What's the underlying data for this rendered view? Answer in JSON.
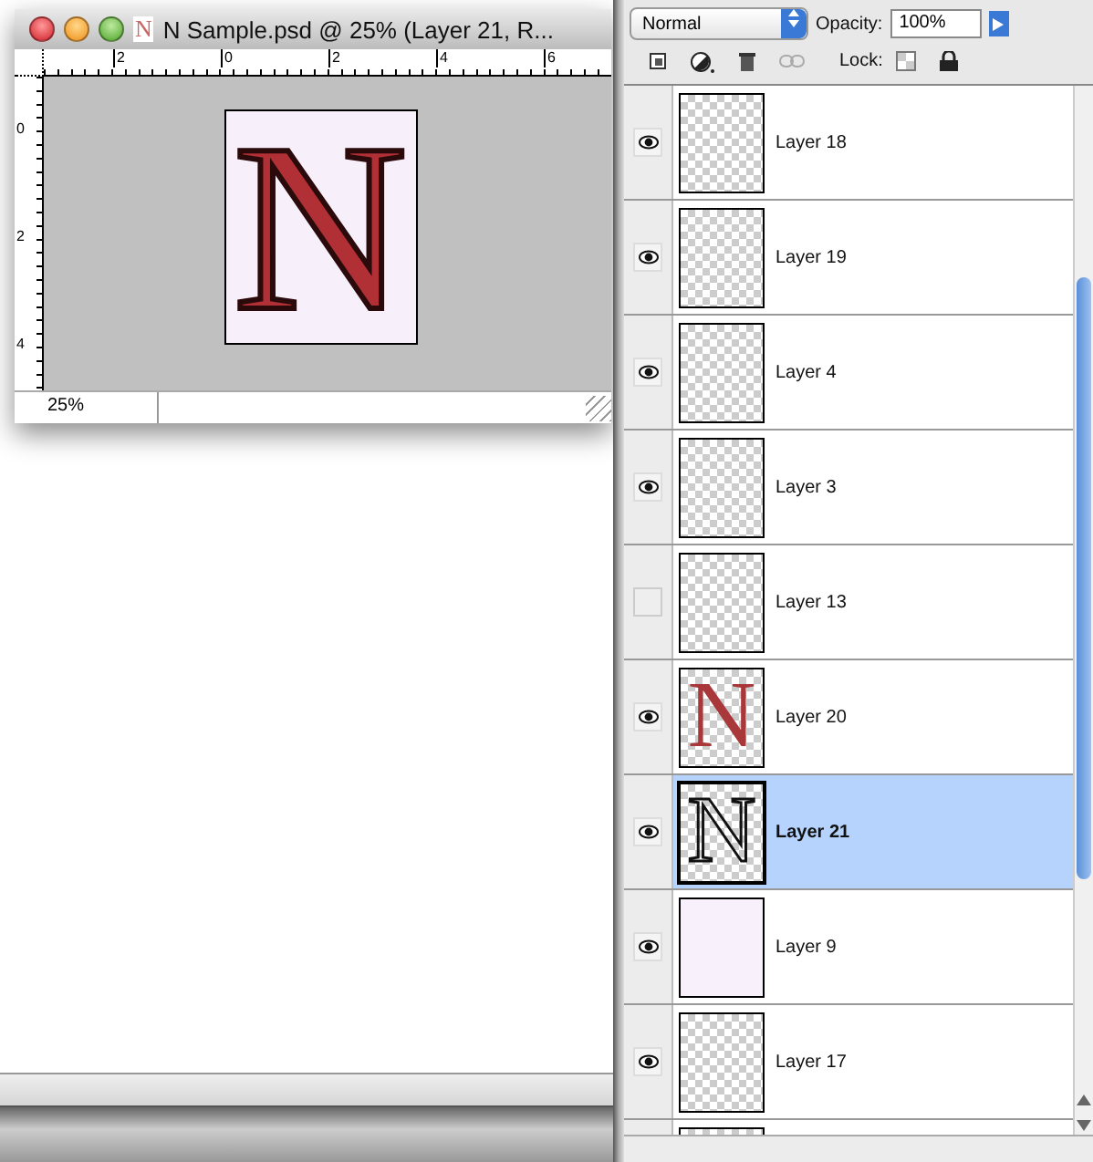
{
  "document": {
    "title": "N Sample.psd @ 25% (Layer 21, R...",
    "title_icon": "N",
    "top_ruler": [
      "2",
      "0",
      "2",
      "4",
      "6"
    ],
    "left_ruler": [
      "0",
      "2",
      "4"
    ],
    "canvas_letter": "N",
    "zoom": "25%"
  },
  "layers_panel": {
    "blend_mode": "Normal",
    "opacity_label": "Opacity:",
    "opacity": "100%",
    "lock_label": "Lock:",
    "layers": [
      {
        "name": "Layer 18",
        "visible": true,
        "selected": false,
        "kind": "empty"
      },
      {
        "name": "Layer 19",
        "visible": true,
        "selected": false,
        "kind": "empty"
      },
      {
        "name": "Layer 4",
        "visible": true,
        "selected": false,
        "kind": "empty"
      },
      {
        "name": "Layer 3",
        "visible": true,
        "selected": false,
        "kind": "empty"
      },
      {
        "name": "Layer 13",
        "visible": false,
        "selected": false,
        "kind": "empty"
      },
      {
        "name": "Layer 20",
        "visible": true,
        "selected": false,
        "kind": "red",
        "letter": "N"
      },
      {
        "name": "Layer 21",
        "visible": true,
        "selected": true,
        "kind": "outline",
        "letter": "N"
      },
      {
        "name": "Layer 9",
        "visible": true,
        "selected": false,
        "kind": "blank"
      },
      {
        "name": "Layer 17",
        "visible": true,
        "selected": false,
        "kind": "empty"
      }
    ]
  }
}
